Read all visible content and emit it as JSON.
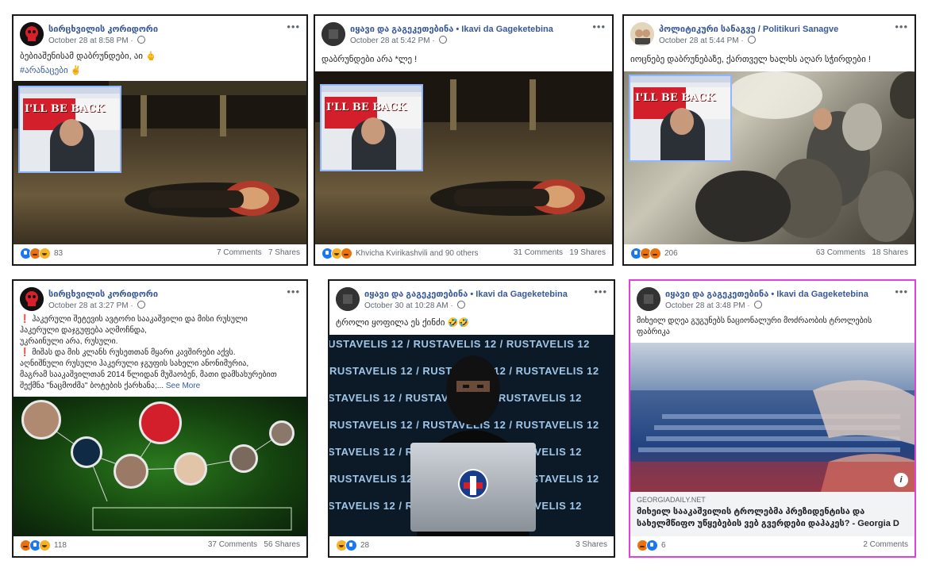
{
  "posts": [
    {
      "page": "სირცხვილის კორიდორი",
      "date": "October 28 at 8:58 PM",
      "text": [
        "ბებიაშენისამ დაბრუნდები, აი 🖕"
      ],
      "hashtag": "#არანაცები ✌️",
      "reaction_count": "83",
      "comments": "7 Comments",
      "shares": "7 Shares",
      "inset_text": "I'LL BE BACK"
    },
    {
      "page": "იყავი და გაგეკეთებინა • Ikavi da Gageketebina",
      "date": "October 28 at 5:42 PM",
      "text": [
        "დაბრუნდები არა *ლე !"
      ],
      "reaction_count": "Khvicha Kvirikashvili and 90 others",
      "comments": "31 Comments",
      "shares": "19 Shares",
      "inset_text": "I'LL BE BACK"
    },
    {
      "page": "პოლიტიკური სანაგვე / Politikuri Sanagve",
      "date": "October 28 at 5:44 PM",
      "text": [
        "იოცნებე დაბრუნებაზე, ქართველ ხალხს აღარ სჭირდები !"
      ],
      "reaction_count": "206",
      "comments": "63 Comments",
      "shares": "18 Shares",
      "inset_text": "I'LL BE BACK"
    },
    {
      "page": "სირცხვილის კორიდორი",
      "date": "October 28 at 3:27 PM",
      "text": [
        "❗ ჰაკერული შეტევის ავტორი სააკაშვილი და მისი რუსული",
        "ჰაკერული დაჯგუფება აღმოჩნდა,",
        "უკრაინული არა, რუსული.",
        "❗ მიშას და მის კლანს რუსეთთან მყარი კავშირები აქვს.",
        "აღნიშნული რუსული ჰაკერული ჯგუფის სახელი ანონიმურია,",
        "მაგრამ სააკაშვილთან 2014 წლიდან მუშაობენ, მათი დამსახურებით",
        "შექმნა \"ნაცმოძმა\" ბოტების ქარხანა;..."
      ],
      "see_more": "See More",
      "reaction_count": "118",
      "comments": "37 Comments",
      "shares": "56 Shares"
    },
    {
      "page": "იყავი და გაგეკეთებინა • Ikavi da Gageketebina",
      "date": "October 30 at 10:28 AM",
      "text": [
        "ტროლი ყოფილა ეს ქინძი 🤣🤣"
      ],
      "reaction_count": "28",
      "comments": "",
      "shares": "3 Shares",
      "banner_text": "RUSTAVELIS 12"
    },
    {
      "page": "იყავი და გაგეკეთებინა • Ikavi da Gageketebina",
      "date": "October 28 at 3:48 PM",
      "text": [
        "მიხეილ დღეა გუგუნებს ნაციონალური მოძრაობის ტროლების",
        "ფაბრიკა"
      ],
      "link_domain": "GEORGIADAILY.NET",
      "link_title": "მიხეილ სააკაშვილის ტროლებმა პრეზიდენტისა და სახელმწიფო უწყებების ვებ გვერდები დაჰაკეს? - Georgia D",
      "reaction_count": "6",
      "comments": "2 Comments",
      "shares": ""
    }
  ],
  "more_glyph": "•••",
  "info_glyph": "i",
  "colors": {
    "link_blue": "#385898",
    "highlight_border": "#e040e0",
    "like": "#1877f2",
    "angry": "#e9710f",
    "haha": "#f7b125"
  }
}
